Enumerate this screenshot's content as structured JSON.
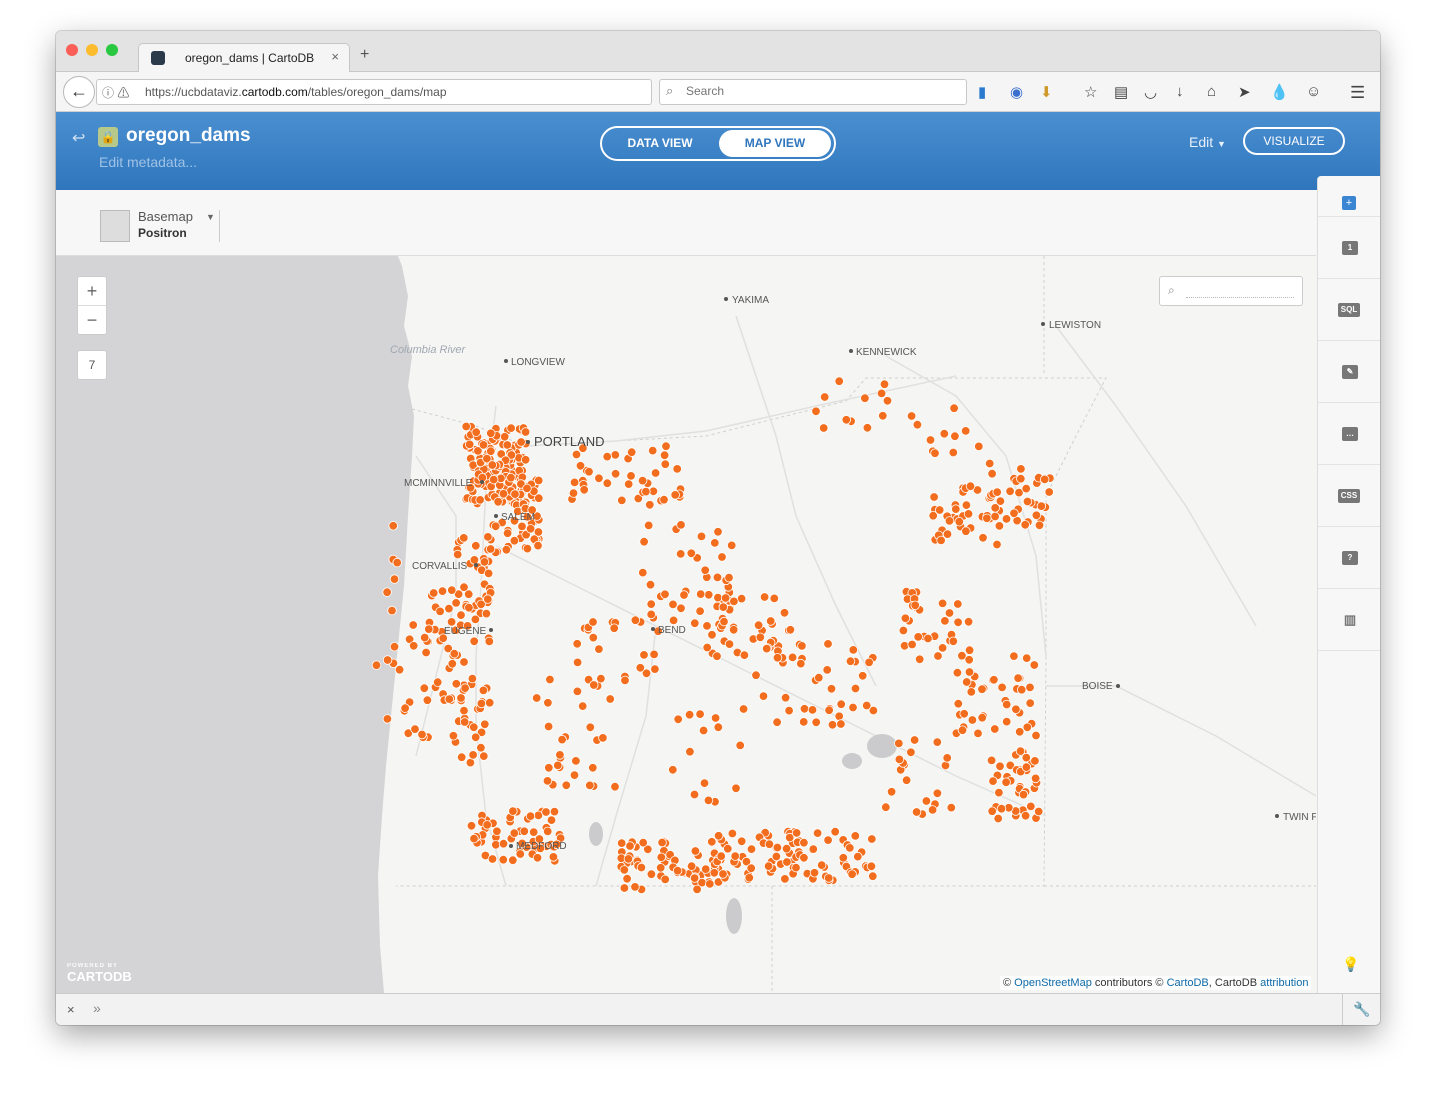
{
  "browser": {
    "tab_title": "oregon_dams | CartoDB",
    "tab_close": "×",
    "new_tab": "+",
    "url_prefix": "https://ucbdataviz.",
    "url_domain": "cartodb.com",
    "url_path": "/tables/oregon_dams/map",
    "search_placeholder": "Search"
  },
  "header": {
    "table_name": "oregon_dams",
    "edit_metadata": "Edit metadata...",
    "data_view": "DATA VIEW",
    "map_view": "MAP VIEW",
    "edit": "Edit",
    "visualize": "VISUALIZE"
  },
  "basemap": {
    "label": "Basemap",
    "name": "Positron"
  },
  "map": {
    "zoom_in": "+",
    "zoom_out": "−",
    "zoom_level": "7",
    "dot_color": "#f26d1d",
    "city_labels": [
      "YAKIMA",
      "LEWISTON",
      "KENNEWICK",
      "LONGVIEW",
      "PORTLAND",
      "MCMINNVILLE",
      "SALEM",
      "CORVALLIS",
      "EUGENE",
      "BEND",
      "BOISE",
      "MEDFORD",
      "TWIN F"
    ],
    "river_label": "Columbia River",
    "logo_small": "POWERED BY",
    "logo_big": "CARTODB",
    "attribution": {
      "c1": "©",
      "osm": "OpenStreetMap",
      "contributors": "contributors ©",
      "cartodb": "CartoDB",
      "cartodb_attr": ", CartoDB",
      "attribution": "attribution"
    }
  },
  "right_panel": {
    "add": "+",
    "items": [
      {
        "icon": "layer-1-icon",
        "label": "1"
      },
      {
        "icon": "sql-icon",
        "label": "SQL"
      },
      {
        "icon": "wizard-icon",
        "label": "✎"
      },
      {
        "icon": "infowindow-icon",
        "label": "…"
      },
      {
        "icon": "css-icon",
        "label": "CSS"
      },
      {
        "icon": "legend-icon",
        "label": "?"
      },
      {
        "icon": "filters-icon",
        "label": "▥"
      }
    ]
  },
  "bottom_bar": {
    "close": "×",
    "expand": "»"
  }
}
